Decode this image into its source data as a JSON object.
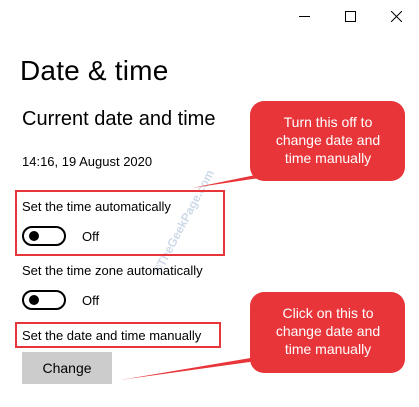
{
  "window": {
    "controls": [
      "minimize",
      "maximize",
      "close"
    ]
  },
  "page": {
    "title": "Date & time",
    "section_title": "Current date and time",
    "current_datetime": "14:16, 19 August 2020"
  },
  "settings": {
    "auto_time": {
      "label": "Set the time automatically",
      "state": "Off"
    },
    "auto_timezone": {
      "label": "Set the time zone automatically",
      "state": "Off"
    },
    "manual": {
      "label": "Set the date and time manually",
      "button_label": "Change"
    }
  },
  "annotations": {
    "callout_top": "Turn this off to change date and time manually",
    "callout_bottom": "Click on this to change date and time manually",
    "watermark": "©TheGeekPage.com",
    "accent_color": "#e8353a"
  }
}
